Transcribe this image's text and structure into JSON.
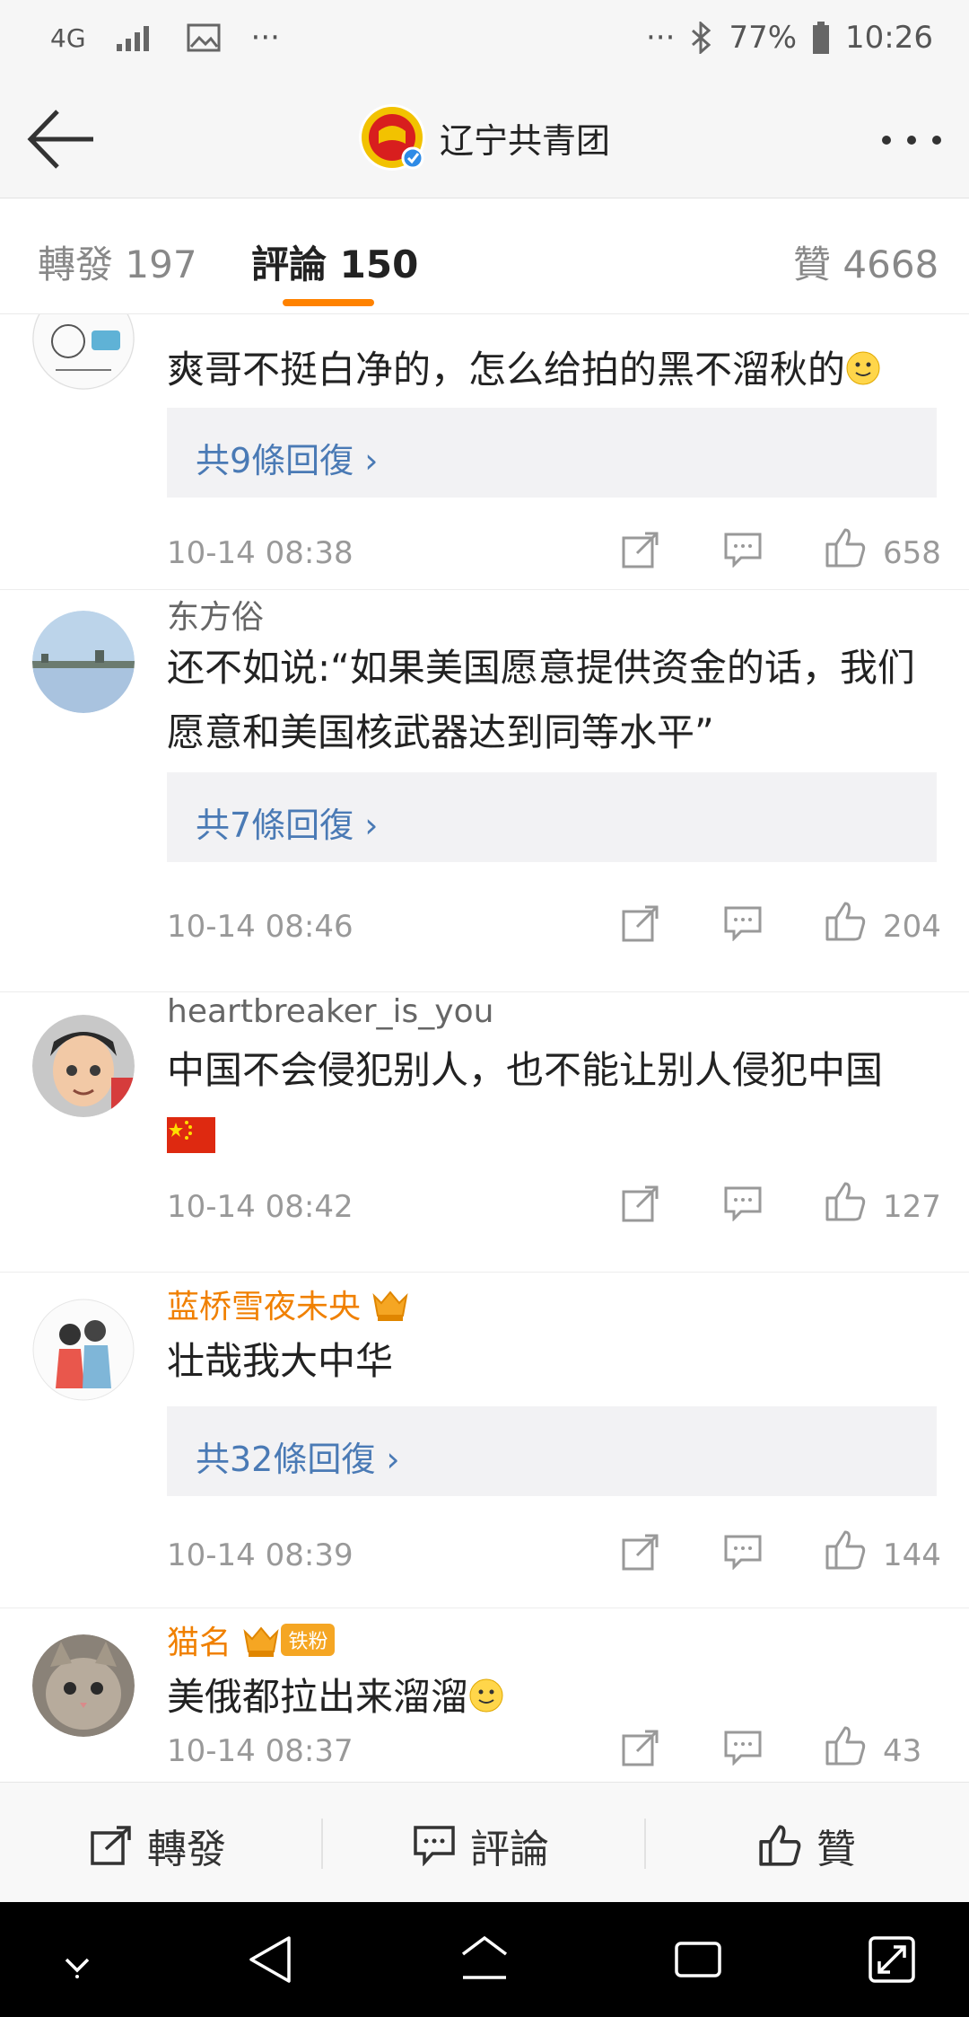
{
  "status_bar": {
    "network": "4G",
    "dots_left": "···",
    "dots_right": "···",
    "battery": "77%",
    "time": "10:26"
  },
  "app_bar": {
    "title": "辽宁共青团"
  },
  "tabs": [
    {
      "label": "轉發",
      "count": "197"
    },
    {
      "label": "評論",
      "count": "150"
    },
    {
      "label": "贊",
      "count": "4668"
    }
  ],
  "comments": [
    {
      "username": "",
      "text": "爽哥不挺白净的，怎么给拍的黑不溜秋的",
      "reply_link": "共9條回復 ›",
      "time": "10-14 08:38",
      "likes": "658"
    },
    {
      "username": "东方俗",
      "text": "还不如说:“如果美国愿意提供资金的话，我们愿意和美国核武器达到同等水平”",
      "reply_link": "共7條回復 ›",
      "time": "10-14 08:46",
      "likes": "204"
    },
    {
      "username": "heartbreaker_is_you",
      "text": "中国不会侵犯别人，也不能让别人侵犯中国",
      "time": "10-14 08:42",
      "likes": "127"
    },
    {
      "username": "蓝桥雪夜未央",
      "text": "壮哉我大中华",
      "reply_link": "共32條回復 ›",
      "time": "10-14 08:39",
      "likes": "144"
    },
    {
      "username": "猫名",
      "badge": "铁粉",
      "text": "美俄都拉出来溜溜",
      "time": "10-14 08:37",
      "likes": "43"
    }
  ],
  "bottom_bar": {
    "repost": "轉發",
    "comment": "評論",
    "like": "贊"
  },
  "colors": {
    "accent": "#ff8200",
    "link": "#4a7ab5",
    "vip_name": "#f08000"
  }
}
